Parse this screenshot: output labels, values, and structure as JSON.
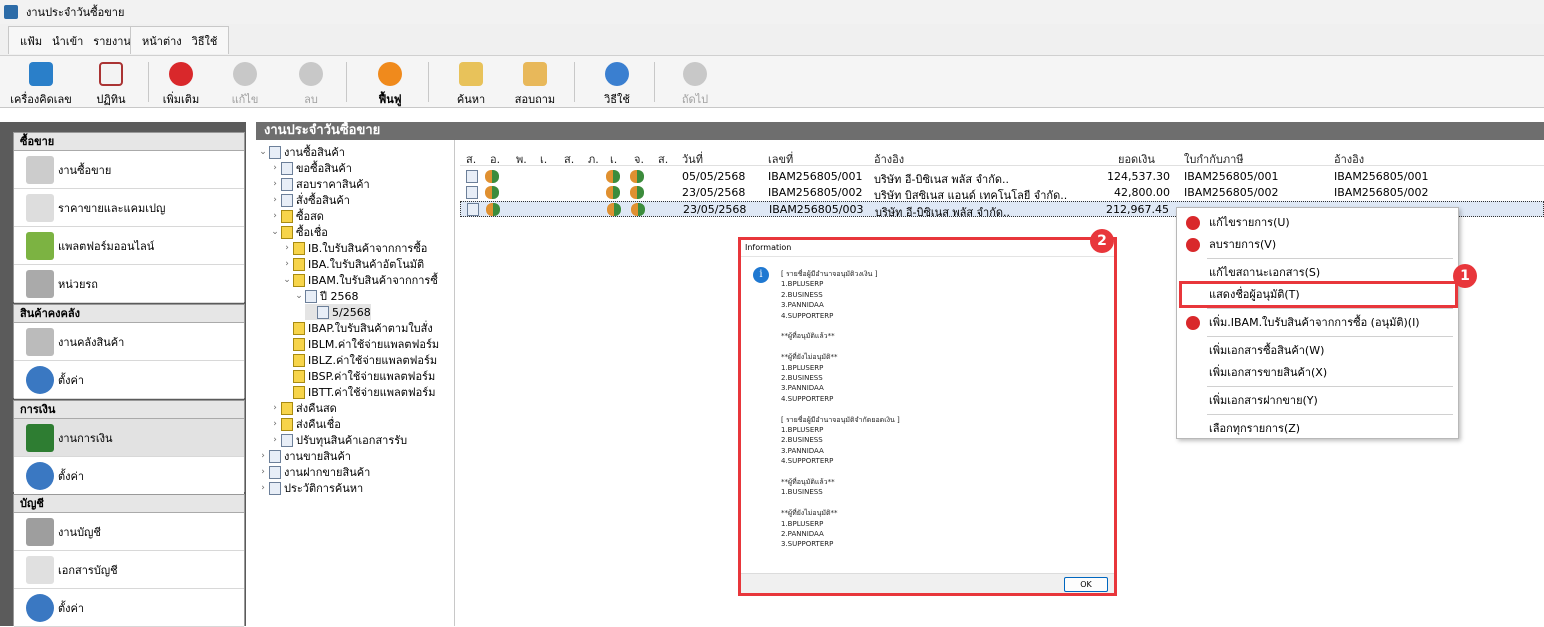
{
  "window": {
    "title": "งานประจำวันซื้อขาย"
  },
  "menu": {
    "group1": [
      "แฟ้ม",
      "นำเข้า",
      "รายงาน"
    ],
    "group2": [
      "หน้าต่าง",
      "วิธีใช้"
    ]
  },
  "toolbar": [
    {
      "label": "เครื่องคิดเลข",
      "icon": "calculator-icon",
      "enabled": true
    },
    {
      "label": "ปฏิทิน",
      "icon": "calendar-icon",
      "enabled": true
    },
    {
      "label": "เพิ่มเติม",
      "icon": "add-icon",
      "enabled": true
    },
    {
      "label": "แก้ไข",
      "icon": "edit-icon",
      "enabled": false
    },
    {
      "label": "ลบ",
      "icon": "delete-icon",
      "enabled": false
    },
    {
      "label": "ฟื้นฟู",
      "icon": "refresh-icon",
      "enabled": true
    },
    {
      "label": "ค้นหา",
      "icon": "search-icon",
      "enabled": true
    },
    {
      "label": "สอบถาม",
      "icon": "phone-icon",
      "enabled": true
    },
    {
      "label": "วิธีใช้",
      "icon": "help-icon",
      "enabled": true
    },
    {
      "label": "ถัดไป",
      "icon": "next-icon",
      "enabled": false
    }
  ],
  "sidebar": [
    {
      "header": "ซื้อขาย",
      "items": [
        "งานซื้อขาย",
        "ราคาขายและแคมเปญ",
        "แพลตฟอร์มออนไลน์",
        "หน่วยรถ"
      ]
    },
    {
      "header": "สินค้าคงคลัง",
      "items": [
        "งานคลังสินค้า",
        "ตั้งค่า"
      ]
    },
    {
      "header": "การเงิน",
      "items": [
        "งานการเงิน",
        "ตั้งค่า"
      ]
    },
    {
      "header": "บัญชี",
      "items": [
        "งานบัญชี",
        "เอกสารบัญชี",
        "ตั้งค่า"
      ]
    }
  ],
  "main": {
    "title": "งานประจำวันซื้อขาย"
  },
  "tree": [
    {
      "label": "งานซื้อสินค้า",
      "level": 0,
      "arrow": "v"
    },
    {
      "label": "ขอซื้อสินค้า",
      "level": 1,
      "arrow": ">"
    },
    {
      "label": "สอบราคาสินค้า",
      "level": 1,
      "arrow": ">"
    },
    {
      "label": "สั่งซื้อสินค้า",
      "level": 1,
      "arrow": ">"
    },
    {
      "label": "ซื้อสด",
      "level": 1,
      "arrow": ">",
      "y": true
    },
    {
      "label": "ซื้อเชื่อ",
      "level": 1,
      "arrow": "v",
      "y": true
    },
    {
      "label": "IB.ใบรับสินค้าจากการซื้อ",
      "level": 2,
      "arrow": ">",
      "y": true
    },
    {
      "label": "IBA.ใบรับสินค้าอัตโนมัติ",
      "level": 2,
      "arrow": ">",
      "y": true
    },
    {
      "label": "IBAM.ใบรับสินค้าจากการซื้",
      "level": 2,
      "arrow": "v",
      "y": true
    },
    {
      "label": "ปี 2568",
      "level": 3,
      "arrow": "v"
    },
    {
      "label": "5/2568",
      "level": 4,
      "arrow": "",
      "sel": true
    },
    {
      "label": "IBAP.ใบรับสินค้าตามใบสั่ง",
      "level": 2,
      "arrow": "",
      "y": true
    },
    {
      "label": "IBLM.ค่าใช้จ่ายแพลตฟอร์ม",
      "level": 2,
      "arrow": "",
      "y": true
    },
    {
      "label": "IBLZ.ค่าใช้จ่ายแพลตฟอร์ม",
      "level": 2,
      "arrow": "",
      "y": true
    },
    {
      "label": "IBSP.ค่าใช้จ่ายแพลตฟอร์ม",
      "level": 2,
      "arrow": "",
      "y": true
    },
    {
      "label": "IBTT.ค่าใช้จ่ายแพลตฟอร์ม",
      "level": 2,
      "arrow": "",
      "y": true
    },
    {
      "label": "ส่งคืนสด",
      "level": 1,
      "arrow": ">",
      "y": true
    },
    {
      "label": "ส่งคืนเชื่อ",
      "level": 1,
      "arrow": ">",
      "y": true
    },
    {
      "label": "ปรับทุนสินค้าเอกสารรับ",
      "level": 1,
      "arrow": ">"
    },
    {
      "label": "งานขายสินค้า",
      "level": 0,
      "arrow": ">"
    },
    {
      "label": "งานฝากขายสินค้า",
      "level": 0,
      "arrow": ">"
    },
    {
      "label": "ประวัติการค้นหา",
      "level": 0,
      "arrow": ">"
    }
  ],
  "grid": {
    "columns": [
      "ส.",
      "อ.",
      "พ.",
      "เ.",
      "ส.",
      "ภ.",
      "เ.",
      "จ.",
      "ส.",
      "วันที่",
      "เลขที่",
      "อ้างอิง",
      "ยอดเงิน",
      "ใบกำกับภาษี",
      "อ้างอิง"
    ],
    "rows": [
      {
        "date": "05/05/2568",
        "no": "IBAM256805/001",
        "ref": "บริษัท อี-บิซิเนส พลัส จำกัด..",
        "amount": "124,537.30",
        "tax": "IBAM256805/001",
        "ref2": "IBAM256805/001",
        "selected": false
      },
      {
        "date": "23/05/2568",
        "no": "IBAM256805/002",
        "ref": "บริษัท บิสซิเนส แอนด์ เทคโนโลยี จำกัด..",
        "amount": "42,800.00",
        "tax": "IBAM256805/002",
        "ref2": "IBAM256805/002",
        "selected": false
      },
      {
        "date": "23/05/2568",
        "no": "IBAM256805/003",
        "ref": "บริษัท อี-บิซิเนส พลัส จำกัด..",
        "amount": "212,967.45",
        "tax": "",
        "ref2": "",
        "selected": true
      }
    ]
  },
  "dialog": {
    "title": "Information",
    "lines": [
      "[ รายชื่อผู้มีอำนาจอนุมัติวงเงิน ]",
      "1.BPLUSERP",
      "2.BUSINESS",
      "3.PANNIDAA",
      "4.SUPPORTERP",
      "",
      "**ผู้ที่อนุมัติแล้ว**",
      "",
      "**ผู้ที่ยังไม่อนุมัติ**",
      "1.BPLUSERP",
      "2.BUSINESS",
      "3.PANNIDAA",
      "4.SUPPORTERP",
      "",
      "[ รายชื่อผู้มีอำนาจอนุมัติจำกัดยอดเงิน ]",
      "1.BPLUSERP",
      "2.BUSINESS",
      "3.PANNIDAA",
      "4.SUPPORTERP",
      "",
      "**ผู้ที่อนุมัติแล้ว**",
      "1.BUSINESS",
      "",
      "**ผู้ที่ยังไม่อนุมัติ**",
      "1.BPLUSERP",
      "2.PANNIDAA",
      "3.SUPPORTERP"
    ],
    "ok_label": "OK"
  },
  "context_menu": [
    {
      "label": "แก้ไขรายการ(U)",
      "icon": "edit-icon"
    },
    {
      "label": "ลบรายการ(V)",
      "icon": "delete-icon"
    },
    {
      "sep": true
    },
    {
      "label": "แก้ไขสถานะเอกสาร(S)"
    },
    {
      "label": "แสดงชื่อผู้อนุมัติ(T)"
    },
    {
      "sep": true
    },
    {
      "label": "เพิ่ม.IBAM.ใบรับสินค้าจากการซื้อ (อนุมัติ)(I)",
      "icon": "add-icon"
    },
    {
      "sep": true
    },
    {
      "label": "เพิ่มเอกสารซื้อสินค้า(W)"
    },
    {
      "label": "เพิ่มเอกสารขายสินค้า(X)"
    },
    {
      "sep": true
    },
    {
      "label": "เพิ่มเอกสารฝากขาย(Y)"
    },
    {
      "sep": true
    },
    {
      "label": "เลือกทุกรายการ(Z)"
    }
  ],
  "badges": [
    "1",
    "2"
  ],
  "colors": {
    "highlight": "#e8363b",
    "sidebar_bg": "#5b5b5b",
    "header_bg": "#6e6e6e"
  }
}
